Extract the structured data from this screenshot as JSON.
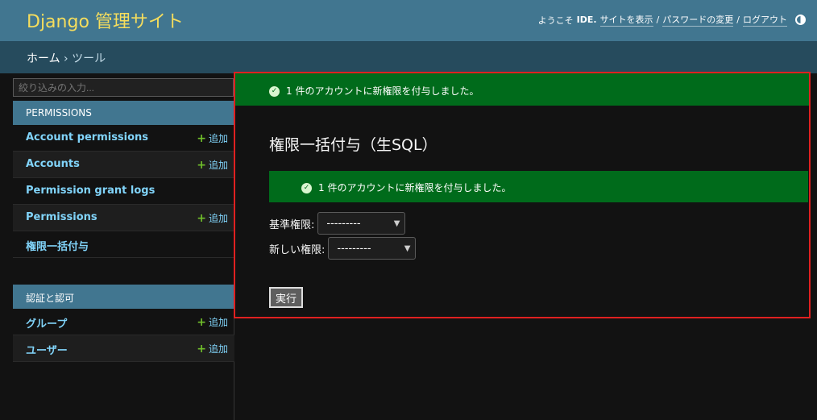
{
  "header": {
    "brand": "Django 管理サイト",
    "welcome": "ようこそ",
    "username": "IDE.",
    "view_site": "サイトを表示",
    "change_password": "パスワードの変更",
    "logout": "ログアウト",
    "separator": "/"
  },
  "breadcrumbs": {
    "home": "ホーム",
    "sep": "›",
    "current": "ツール"
  },
  "sidebar": {
    "filter_placeholder": "絞り込みの入力...",
    "apps": [
      {
        "caption": "PERMISSIONS",
        "models": [
          {
            "name": "Account permissions",
            "add": "追加"
          },
          {
            "name": "Accounts",
            "add": "追加"
          },
          {
            "name": "Permission grant logs",
            "add": ""
          },
          {
            "name": "Permissions",
            "add": "追加"
          },
          {
            "name": "権限一括付与",
            "add": ""
          }
        ]
      },
      {
        "caption": "認証と認可",
        "models": [
          {
            "name": "グループ",
            "add": "追加"
          },
          {
            "name": "ユーザー",
            "add": "追加"
          }
        ]
      }
    ]
  },
  "content": {
    "message": "1 件のアカウントに新権限を付与しました。",
    "title": "権限一括付与（生SQL）",
    "inner_message": "1 件のアカウントに新権限を付与しました。",
    "base_permission_label": "基準権限:",
    "base_permission_value": "---------",
    "new_permission_label": "新しい権限:",
    "new_permission_value": "---------",
    "submit_label": "実行"
  },
  "colors": {
    "header_bg": "#417690",
    "brand": "#f5dd5d",
    "breadcrumb_bg": "#264b5d",
    "success_bg": "#006b1b",
    "link": "#81d4fa",
    "highlight_border": "#e02020"
  },
  "icons": [
    "theme-toggle-icon",
    "success-check-icon",
    "add-plus-icon",
    "chevron-down-icon"
  ]
}
